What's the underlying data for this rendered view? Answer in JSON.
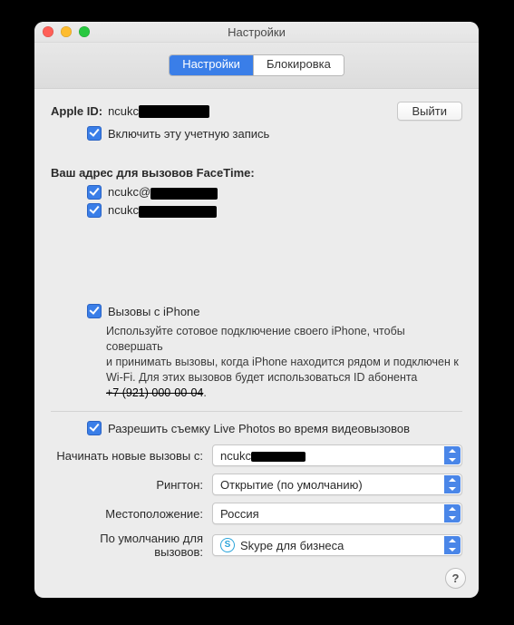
{
  "window": {
    "title": "Настройки"
  },
  "tabs": {
    "settings": "Настройки",
    "block": "Блокировка"
  },
  "appleId": {
    "label": "Apple ID:",
    "prefix": "ncukc",
    "signout": "Выйти",
    "enable": "Включить эту учетную запись"
  },
  "facetime": {
    "heading": "Ваш адрес для вызовов FaceTime:",
    "addr1_prefix": "ncukc@",
    "addr2_prefix": "ncukc"
  },
  "iphone": {
    "label": "Вызовы с iPhone",
    "desc_l1": "Используйте сотовое подключение своего iPhone, чтобы совершать",
    "desc_l2": "и принимать вызовы, когда iPhone находится рядом и подключен к",
    "desc_l3a": "Wi-Fi. Для этих вызовов будет использоваться ID абонента ",
    "desc_red": "+7 (921) 000-00-04",
    "desc_tail": "."
  },
  "livephotos": {
    "label": "Разрешить съемку Live Photos во время видеовызовов"
  },
  "form": {
    "start_label": "Начинать новые вызовы с:",
    "start_val_prefix": "ncukc",
    "ringtone_label": "Рингтон:",
    "ringtone_val": "Открытие (по умолчанию)",
    "location_label": "Местоположение:",
    "location_val": "Россия",
    "default_label": "По умолчанию для вызовов:",
    "default_val": "Skype для бизнеса"
  },
  "help": "?"
}
